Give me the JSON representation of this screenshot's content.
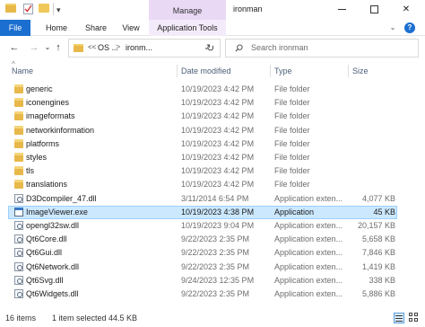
{
  "window": {
    "title": "ironman",
    "manage_label": "Manage",
    "minimize_label": "—",
    "maximize_label": "",
    "close_label": "✕"
  },
  "ribbon": {
    "tabs": [
      "File",
      "Home",
      "Share",
      "View",
      "Application Tools"
    ]
  },
  "nav": {
    "address_prefix": "<<",
    "address_parent": "OS ...",
    "address_separator": ">",
    "address_current": "ironm...",
    "search_placeholder": "Search ironman"
  },
  "columns": {
    "name": "Name",
    "date": "Date modified",
    "type": "Type",
    "size": "Size"
  },
  "files": [
    {
      "name": "generic",
      "date": "10/19/2023 4:42 PM",
      "type": "File folder",
      "size": "",
      "icon": "folder-icon"
    },
    {
      "name": "iconengines",
      "date": "10/19/2023 4:42 PM",
      "type": "File folder",
      "size": "",
      "icon": "folder-icon"
    },
    {
      "name": "imageformats",
      "date": "10/19/2023 4:42 PM",
      "type": "File folder",
      "size": "",
      "icon": "folder-icon"
    },
    {
      "name": "networkinformation",
      "date": "10/19/2023 4:42 PM",
      "type": "File folder",
      "size": "",
      "icon": "folder-icon"
    },
    {
      "name": "platforms",
      "date": "10/19/2023 4:42 PM",
      "type": "File folder",
      "size": "",
      "icon": "folder-icon"
    },
    {
      "name": "styles",
      "date": "10/19/2023 4:42 PM",
      "type": "File folder",
      "size": "",
      "icon": "folder-icon"
    },
    {
      "name": "tls",
      "date": "10/19/2023 4:42 PM",
      "type": "File folder",
      "size": "",
      "icon": "folder-icon"
    },
    {
      "name": "translations",
      "date": "10/19/2023 4:42 PM",
      "type": "File folder",
      "size": "",
      "icon": "folder-icon"
    },
    {
      "name": "D3Dcompiler_47.dll",
      "date": "3/11/2014 6:54 PM",
      "type": "Application exten...",
      "size": "4,077 KB",
      "icon": "dll-file-icon"
    },
    {
      "name": "ImageViewer.exe",
      "date": "10/19/2023 4:38 PM",
      "type": "Application",
      "size": "45 KB",
      "icon": "exe-file-icon",
      "selected": true
    },
    {
      "name": "opengl32sw.dll",
      "date": "10/19/2023 9:04 PM",
      "type": "Application exten...",
      "size": "20,157 KB",
      "icon": "dll-file-icon"
    },
    {
      "name": "Qt6Core.dll",
      "date": "9/22/2023 2:35 PM",
      "type": "Application exten...",
      "size": "5,658 KB",
      "icon": "dll-file-icon"
    },
    {
      "name": "Qt6Gui.dll",
      "date": "9/22/2023 2:35 PM",
      "type": "Application exten...",
      "size": "7,846 KB",
      "icon": "dll-file-icon"
    },
    {
      "name": "Qt6Network.dll",
      "date": "9/22/2023 2:35 PM",
      "type": "Application exten...",
      "size": "1,419 KB",
      "icon": "dll-file-icon"
    },
    {
      "name": "Qt6Svg.dll",
      "date": "9/24/2023 12:35 PM",
      "type": "Application exten...",
      "size": "338 KB",
      "icon": "dll-file-icon"
    },
    {
      "name": "Qt6Widgets.dll",
      "date": "9/22/2023 2:35 PM",
      "type": "Application exten...",
      "size": "5,886 KB",
      "icon": "dll-file-icon"
    }
  ],
  "status": {
    "count": "16 items",
    "selection": "1 item selected  44.5 KB"
  },
  "colors": {
    "file_tab": "#1b6fd0",
    "manage_tab": "#e9d9f5",
    "selection": "#cce8ff",
    "folder": "#e8b84a"
  }
}
